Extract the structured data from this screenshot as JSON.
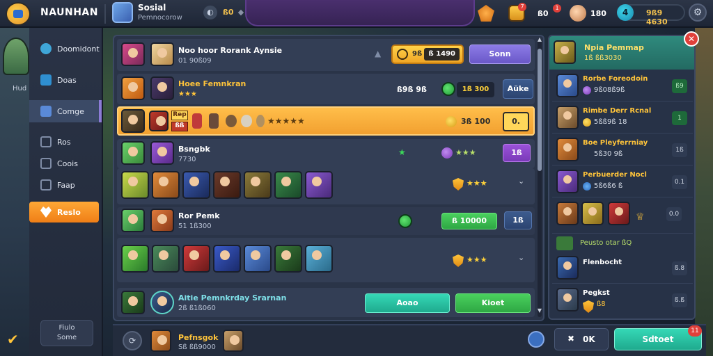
{
  "topbar": {
    "brand": "NAUNHAN",
    "player_name": "Sosial",
    "player_sub": "Pemnocorow",
    "level_text": "ß0",
    "badge_7": "7",
    "badge_1": "1",
    "resource_a": "ß0",
    "resource_b": "180",
    "money_symbol": "4",
    "money_amount": "9ß9 4630",
    "settings_icon": "gear-icon"
  },
  "sidebar": {
    "items": [
      {
        "label": "Doomidont",
        "icon": "compass-icon"
      },
      {
        "label": "Doas",
        "icon": "swords-icon"
      },
      {
        "label": "Comge",
        "icon": "flag-icon"
      },
      {
        "label": "Ros",
        "icon": "book-icon"
      },
      {
        "label": "Coois",
        "icon": "bag-icon"
      },
      {
        "label": "Faap",
        "icon": "map-icon"
      },
      {
        "label": "Reslo",
        "icon": "heart-icon"
      }
    ],
    "bottom_line1": "Fiulo",
    "bottom_line2": "Some",
    "left_label": "Hud"
  },
  "main": {
    "row1": {
      "name": "Noo hoor Rorank Aynsie",
      "sub": "01 90ß09",
      "pill_left": "9ß",
      "pill_right": "ß 1490",
      "button": "Sonn"
    },
    "row2": {
      "name": "Hoee Femnkran",
      "sub": "★★★",
      "value": "ß9ß 9ß",
      "pill": "1ß 300",
      "button": "Aüke"
    },
    "row3": {
      "tag1": "Rep",
      "tag2": "ßß",
      "stars": "★★★★★",
      "value": "3ß 100",
      "button": "0."
    },
    "row4": {
      "name": "Bsngbk",
      "sub": "7730",
      "stars": "★★★",
      "button": "1ß"
    },
    "row5": {
      "stars": "★★★",
      "chevron": "⌄"
    },
    "row6": {
      "name": "Ror Pemk",
      "sub": "51 1ß300",
      "pill": "ß 10000",
      "button": "1ß"
    },
    "row7": {
      "stars": "★★★",
      "chevron": "⌄"
    },
    "row8": {
      "name": "Aitie Pemnkrday Srarnan",
      "sub": "2ß ß1ß060",
      "button1": "Aoao",
      "button2": "Kioet"
    },
    "bottom": {
      "name": "Pefnsgok",
      "sub": "Sß ßß9000"
    }
  },
  "right_panel": {
    "title": "Npia Pemmap",
    "sub": "1ß ßß3030",
    "rows": [
      {
        "name": "Rorbe Foreodoin",
        "value": "9ß08ß9ß",
        "badge": "ß9"
      },
      {
        "name": "Rimbe Derr Rcnal",
        "value": "5ßß9ß 18",
        "badge": "1"
      },
      {
        "name": "Boe Pleyferrniay",
        "value": "5ß30 9ß",
        "badge": "1ß"
      },
      {
        "name": "Perbuerder Nocl",
        "value": "5ß6ß6 ß",
        "badge": "0.1"
      },
      {
        "name": "Peusto otar ßQ",
        "value": "",
        "badge": "0.0"
      },
      {
        "name": "Flenbocht",
        "value": "",
        "badge": "ß.8"
      },
      {
        "name": "Pegkst",
        "value": "ß8",
        "badge": "ß.ß"
      }
    ],
    "ok_label": "0K",
    "select_label": "Sdtoet",
    "select_badge": "11"
  },
  "colors": {
    "accent_orange": "#f08a1e",
    "accent_teal": "#2cc8a6",
    "accent_purple": "#7a66d8",
    "panel": "#2a3448"
  }
}
